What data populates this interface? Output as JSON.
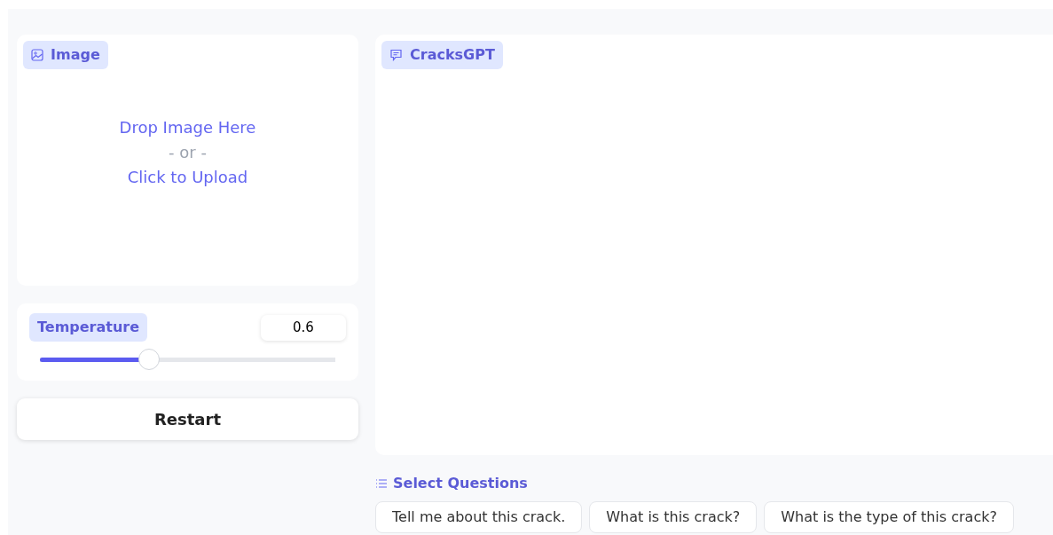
{
  "image_panel": {
    "label": "Image",
    "drop_text": "Drop Image Here",
    "or_text": "- or -",
    "upload_text": "Click to Upload"
  },
  "temperature": {
    "label": "Temperature",
    "value": "0.6",
    "level": 0.37
  },
  "restart_button": "Restart",
  "chat_panel": {
    "label": "CracksGPT"
  },
  "questions": {
    "label": "Select Questions",
    "items": [
      "Tell me about this crack.",
      "What is this crack?",
      "What is the type of this crack?"
    ]
  }
}
